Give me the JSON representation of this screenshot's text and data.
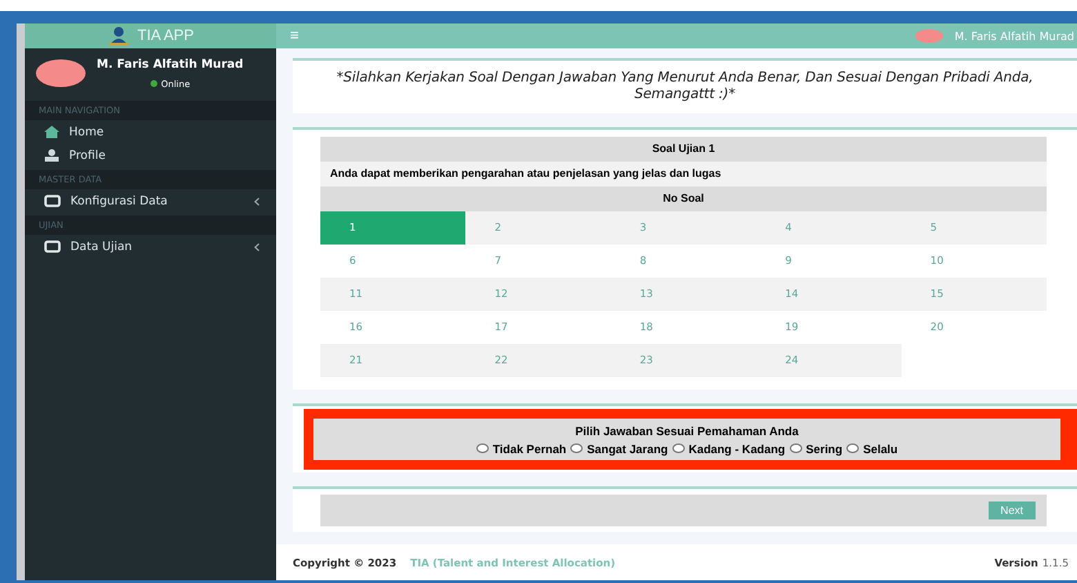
{
  "app": {
    "name": "TIA APP"
  },
  "user": {
    "name": "M. Faris Alfatih Murad",
    "status": "Online"
  },
  "sidebar": {
    "sections": [
      {
        "header": "MAIN NAVIGATION",
        "items": [
          {
            "label": "Home",
            "kind": "home",
            "has_submenu": false
          },
          {
            "label": "Profile",
            "kind": "profile",
            "has_submenu": false
          }
        ]
      },
      {
        "header": "MASTER DATA",
        "items": [
          {
            "label": "Konfigurasi Data",
            "kind": "data",
            "has_submenu": true
          }
        ]
      },
      {
        "header": "UJIAN",
        "items": [
          {
            "label": "Data Ujian",
            "kind": "data",
            "has_submenu": true
          }
        ]
      }
    ]
  },
  "topbar": {
    "menu_icon": "≡",
    "user_name": "M. Faris Alfatih Murad"
  },
  "instruction": "*Silahkan Kerjakan Soal Dengan Jawaban Yang Menurut Anda Benar, Dan Sesuai Dengan Pribadi Anda, Semangattt :)*",
  "question": {
    "title": "Soal Ujian 1",
    "text": "Anda dapat memberikan pengarahan atau penjelasan yang jelas dan lugas",
    "numbers_header": "No Soal",
    "numbers": [
      {
        "label": "1",
        "selected": true
      },
      {
        "label": "2",
        "selected": false
      },
      {
        "label": "3",
        "selected": false
      },
      {
        "label": "4",
        "selected": false
      },
      {
        "label": "5",
        "selected": false
      },
      {
        "label": "6",
        "selected": false
      },
      {
        "label": "7",
        "selected": false
      },
      {
        "label": "8",
        "selected": false
      },
      {
        "label": "9",
        "selected": false
      },
      {
        "label": "10",
        "selected": false
      },
      {
        "label": "11",
        "selected": false
      },
      {
        "label": "12",
        "selected": false
      },
      {
        "label": "13",
        "selected": false
      },
      {
        "label": "14",
        "selected": false
      },
      {
        "label": "15",
        "selected": false
      },
      {
        "label": "16",
        "selected": false
      },
      {
        "label": "17",
        "selected": false
      },
      {
        "label": "18",
        "selected": false
      },
      {
        "label": "19",
        "selected": false
      },
      {
        "label": "20",
        "selected": false
      },
      {
        "label": "21",
        "selected": false
      },
      {
        "label": "22",
        "selected": false
      },
      {
        "label": "23",
        "selected": false
      },
      {
        "label": "24",
        "selected": false
      }
    ]
  },
  "answer": {
    "title": "Pilih Jawaban Sesuai Pemahaman Anda",
    "highlighted": true,
    "options": [
      {
        "label": "Tidak Pernah",
        "selected": false
      },
      {
        "label": "Sangat Jarang",
        "selected": false
      },
      {
        "label": "Kadang - Kadang",
        "selected": false
      },
      {
        "label": "Sering",
        "selected": false
      },
      {
        "label": "Selalu",
        "selected": false
      }
    ]
  },
  "next_button": "Next",
  "footer": {
    "copyright": "Copyright © 2023",
    "link": "TIA (Talent and Interest Allocation)",
    "version_label": "Version",
    "version": "1.1.5"
  }
}
